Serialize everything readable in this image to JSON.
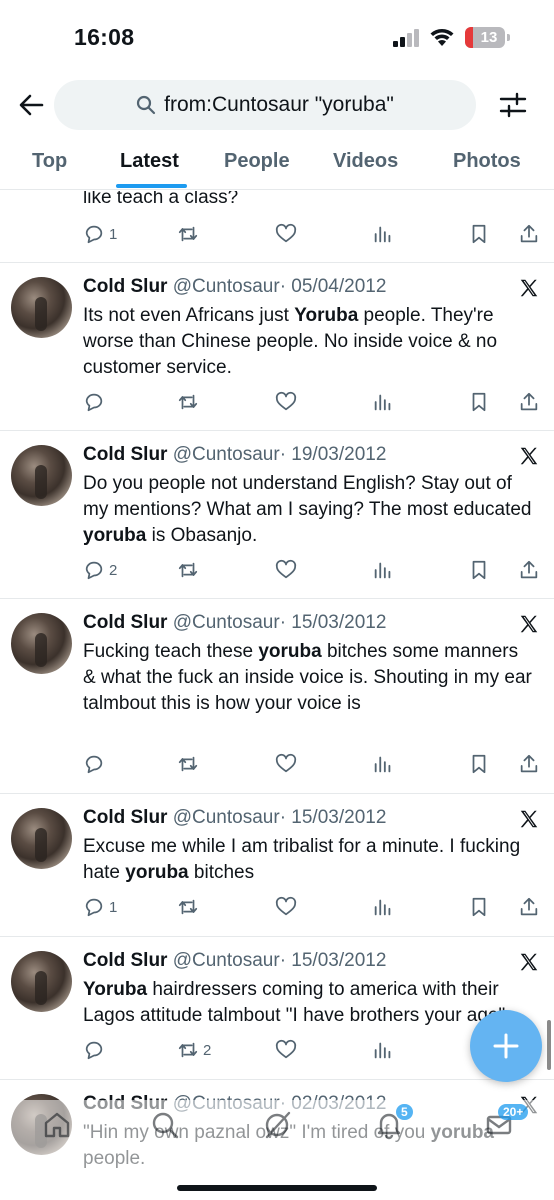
{
  "status": {
    "time": "16:08",
    "battery": "13",
    "battery_level": 0.13
  },
  "header": {
    "query": "from:Cuntosaur \"yoruba\""
  },
  "tabs": [
    {
      "label": "Top"
    },
    {
      "label": "Latest"
    },
    {
      "label": "People"
    },
    {
      "label": "Videos"
    },
    {
      "label": "Photos"
    }
  ],
  "active_tab": "Latest",
  "partial_tweet": {
    "text": "like teach a class?",
    "replies": "1"
  },
  "tweets": [
    {
      "name": "Cold Slur",
      "handle": "@Cuntosaur",
      "sep": "·",
      "date": "05/04/2012",
      "pre": "Its not even Africans just ",
      "bold": "Yoruba",
      "post": " people. They're worse than Chinese people. No inside voice & no customer service.",
      "replies": "",
      "retweets": ""
    },
    {
      "name": "Cold Slur",
      "handle": "@Cuntosaur",
      "sep": "·",
      "date": "19/03/2012",
      "pre": "Do you people not understand English? Stay out of my mentions? What am I saying? The most educated ",
      "bold": "yoruba",
      "post": " is Obasanjo.",
      "replies": "2",
      "retweets": ""
    },
    {
      "name": "Cold Slur",
      "handle": "@Cuntosaur",
      "sep": "·",
      "date": "15/03/2012",
      "pre": "Fucking teach these ",
      "bold": "yoruba",
      "post": " bitches some manners & what the fuck an inside voice is. Shouting in my ear talmbout this is how your voice is",
      "replies": "",
      "retweets": ""
    },
    {
      "name": "Cold Slur",
      "handle": "@Cuntosaur",
      "sep": "·",
      "date": "15/03/2012",
      "pre": "Excuse me while I am tribalist for a minute. I fucking hate ",
      "bold": "yoruba",
      "post": " bitches",
      "replies": "1",
      "retweets": ""
    },
    {
      "name": "Cold Slur",
      "handle": "@Cuntosaur",
      "sep": "·",
      "date": "15/03/2012",
      "pre": "",
      "bold": "Yoruba",
      "post": " hairdressers coming to america with their Lagos attitude talmbout \"I have brothers your age\".",
      "replies": "",
      "retweets": "2"
    },
    {
      "name": "Cold Slur",
      "handle": "@Cuntosaur",
      "sep": "·",
      "date": "02/03/2012",
      "pre": "\"Hin my own paznal owz\" I'm tired of you ",
      "bold": "yoruba",
      "post": " people.",
      "replies": "",
      "retweets": ""
    }
  ],
  "nav_badges": {
    "notifications": "5",
    "messages": "20+"
  },
  "icons": {
    "back": "arrow-left-icon",
    "search": "search-icon",
    "filter": "sliders-icon",
    "reply": "reply-icon",
    "retweet": "retweet-icon",
    "like": "heart-icon",
    "views": "bar-chart-icon",
    "bookmark": "bookmark-icon",
    "share": "share-icon",
    "x": "x-logo-icon",
    "compose": "plus-icon",
    "home": "home-icon",
    "explore": "search-icon",
    "grok": "grok-icon",
    "notifications": "bell-icon",
    "messages": "envelope-icon"
  },
  "colors": {
    "accent": "#1d9bf0",
    "text": "#0f1419",
    "muted": "#536471",
    "fab": "#64b4f2"
  }
}
